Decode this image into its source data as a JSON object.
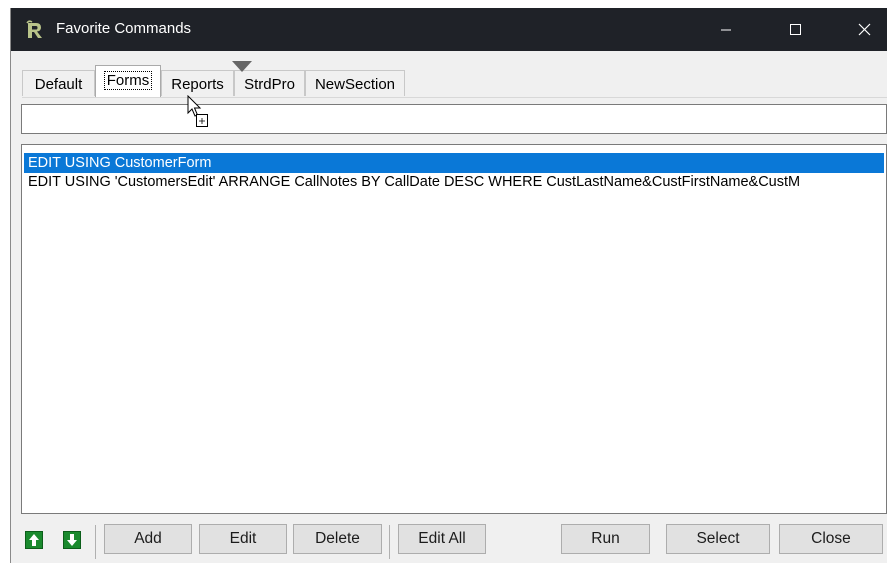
{
  "window": {
    "title": "Favorite Commands"
  },
  "tabs": [
    {
      "label": "Default"
    },
    {
      "label": "Forms"
    },
    {
      "label": "Reports"
    },
    {
      "label": "StrdPro"
    },
    {
      "label": "NewSection"
    }
  ],
  "active_tab": "Forms",
  "filter": {
    "value": ""
  },
  "commands": [
    {
      "text": "EDIT USING CustomerForm",
      "selected": true
    },
    {
      "text": "EDIT USING 'CustomersEdit' ARRANGE CallNotes  BY CallDate DESC WHERE CustLastName&CustFirstName&CustM",
      "selected": false
    }
  ],
  "toolbar": {
    "add_label": "Add",
    "edit_label": "Edit",
    "delete_label": "Delete",
    "edit_all_label": "Edit All",
    "run_label": "Run",
    "select_label": "Select",
    "close_label": "Close"
  },
  "icons": {
    "app": "r-logo-icon",
    "move_up": "arrow-up-icon",
    "move_down": "arrow-down-icon",
    "drag_cursor": "drag-drop-cursor-icon"
  },
  "colors": {
    "titlebar": "#1f2228",
    "selection": "#0a78d7",
    "arrow_green": "#1a8a2e"
  }
}
